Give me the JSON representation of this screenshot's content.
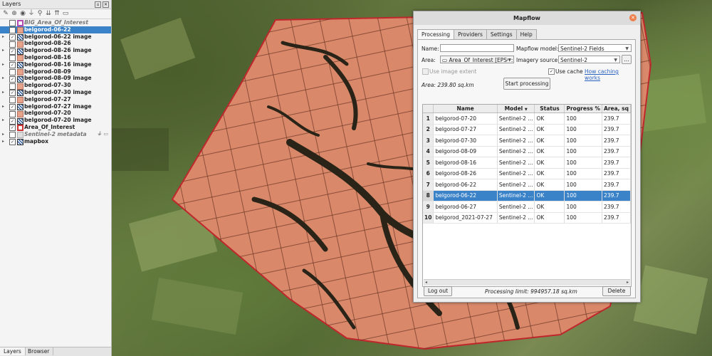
{
  "layers_panel": {
    "title": "Layers",
    "items": [
      {
        "label": "BIG_Area_Of_Interest",
        "symbol": "outline-p",
        "checked": false,
        "expand": "",
        "selected": false,
        "italic": true
      },
      {
        "label": "belgorod-06-22",
        "symbol": "fill",
        "checked": true,
        "expand": "",
        "selected": true,
        "italic": false
      },
      {
        "label": "belgorod-06-22 image",
        "symbol": "raster",
        "checked": true,
        "expand": "▸",
        "selected": false,
        "italic": false
      },
      {
        "label": "belgorod-08-26",
        "symbol": "fill",
        "checked": false,
        "expand": "",
        "selected": false,
        "italic": false
      },
      {
        "label": "belgorod-08-26 image",
        "symbol": "raster",
        "checked": true,
        "expand": "▸",
        "selected": false,
        "italic": false
      },
      {
        "label": "belgorod-08-16",
        "symbol": "fill",
        "checked": false,
        "expand": "",
        "selected": false,
        "italic": false
      },
      {
        "label": "belgorod-08-16 image",
        "symbol": "raster",
        "checked": true,
        "expand": "▸",
        "selected": false,
        "italic": false
      },
      {
        "label": "belgorod-08-09",
        "symbol": "fill",
        "checked": false,
        "expand": "",
        "selected": false,
        "italic": false
      },
      {
        "label": "belgorod-08-09 image",
        "symbol": "raster",
        "checked": true,
        "expand": "▸",
        "selected": false,
        "italic": false
      },
      {
        "label": "belgorod-07-30",
        "symbol": "fill",
        "checked": false,
        "expand": "",
        "selected": false,
        "italic": false
      },
      {
        "label": "belgorod-07-30 image",
        "symbol": "raster",
        "checked": true,
        "expand": "▸",
        "selected": false,
        "italic": false
      },
      {
        "label": "belgorod-07-27",
        "symbol": "fill",
        "checked": false,
        "expand": "",
        "selected": false,
        "italic": false
      },
      {
        "label": "belgorod-07-27 image",
        "symbol": "raster",
        "checked": true,
        "expand": "▸",
        "selected": false,
        "italic": false
      },
      {
        "label": "belgorod-07-20",
        "symbol": "fill",
        "checked": false,
        "expand": "",
        "selected": false,
        "italic": false
      },
      {
        "label": "belgorod-07-20 image",
        "symbol": "raster",
        "checked": true,
        "expand": "▸",
        "selected": false,
        "italic": false
      },
      {
        "label": "Area_Of_Interest",
        "symbol": "outline-r",
        "checked": true,
        "expand": "",
        "selected": false,
        "italic": false
      },
      {
        "label": "Sentinel-2 metadata",
        "symbol": "meta",
        "checked": false,
        "expand": "▸",
        "selected": false,
        "italic": true
      },
      {
        "label": "mapbox",
        "symbol": "raster",
        "checked": true,
        "expand": "▸",
        "selected": false,
        "italic": false
      }
    ],
    "bottom_tabs": [
      "Layers",
      "Browser"
    ]
  },
  "mapflow": {
    "title": "Mapflow",
    "tabs": [
      "Processing",
      "Providers",
      "Settings",
      "Help"
    ],
    "active_tab": "Processing",
    "name_label": "Name:",
    "name_value": "",
    "model_label": "Mapflow model:",
    "model_value": "Sentinel-2 Fields",
    "area_label": "Area:",
    "area_value": "Area_Of_Interest [EPSG:",
    "imagery_label": "Imagery source:",
    "imagery_value": "Sentinel-2",
    "imagery_more": "...",
    "use_image_extent": "Use image extent",
    "use_cache": "Use cache",
    "use_cache_checked": true,
    "caching_link": "How caching works",
    "area_text": "Area: 239.80 sq.km",
    "start_button": "Start processing",
    "table": {
      "columns": [
        "Name",
        "Model",
        "Status",
        "Progress %",
        "Area, sq"
      ],
      "selected_row": 8,
      "rows": [
        {
          "n": "1",
          "name": "belgorod-07-20",
          "model": "Sentinel-2 ...",
          "status": "OK",
          "progress": "100",
          "area": "239.7"
        },
        {
          "n": "2",
          "name": "belgorod-07-27",
          "model": "Sentinel-2 ...",
          "status": "OK",
          "progress": "100",
          "area": "239.7"
        },
        {
          "n": "3",
          "name": "belgorod-07-30",
          "model": "Sentinel-2 ...",
          "status": "OK",
          "progress": "100",
          "area": "239.7"
        },
        {
          "n": "4",
          "name": "belgorod-08-09",
          "model": "Sentinel-2 ...",
          "status": "OK",
          "progress": "100",
          "area": "239.7"
        },
        {
          "n": "5",
          "name": "belgorod-08-16",
          "model": "Sentinel-2 ...",
          "status": "OK",
          "progress": "100",
          "area": "239.7"
        },
        {
          "n": "6",
          "name": "belgorod-08-26",
          "model": "Sentinel-2 ...",
          "status": "OK",
          "progress": "100",
          "area": "239.7"
        },
        {
          "n": "7",
          "name": "belgorod-06-22",
          "model": "Sentinel-2 ...",
          "status": "OK",
          "progress": "100",
          "area": "239.7"
        },
        {
          "n": "8",
          "name": "belgorod-06-22",
          "model": "Sentinel-2 ...",
          "status": "OK",
          "progress": "100",
          "area": "239.7"
        },
        {
          "n": "9",
          "name": "belgorod-06-27",
          "model": "Sentinel-2 ...",
          "status": "OK",
          "progress": "100",
          "area": "239.7"
        },
        {
          "n": "10",
          "name": "belgorod_2021-07-27",
          "model": "Sentinel-2 ...",
          "status": "OK",
          "progress": "100",
          "area": "239.7"
        }
      ]
    },
    "logout_button": "Log out",
    "processing_limit": "Processing limit: 994957.18 sq.km",
    "delete_button": "Delete"
  },
  "colors": {
    "selection": "#3b83c9",
    "field_fill": "#d9896a",
    "aoi_outline": "#c0272d",
    "link": "#2a62c0"
  }
}
